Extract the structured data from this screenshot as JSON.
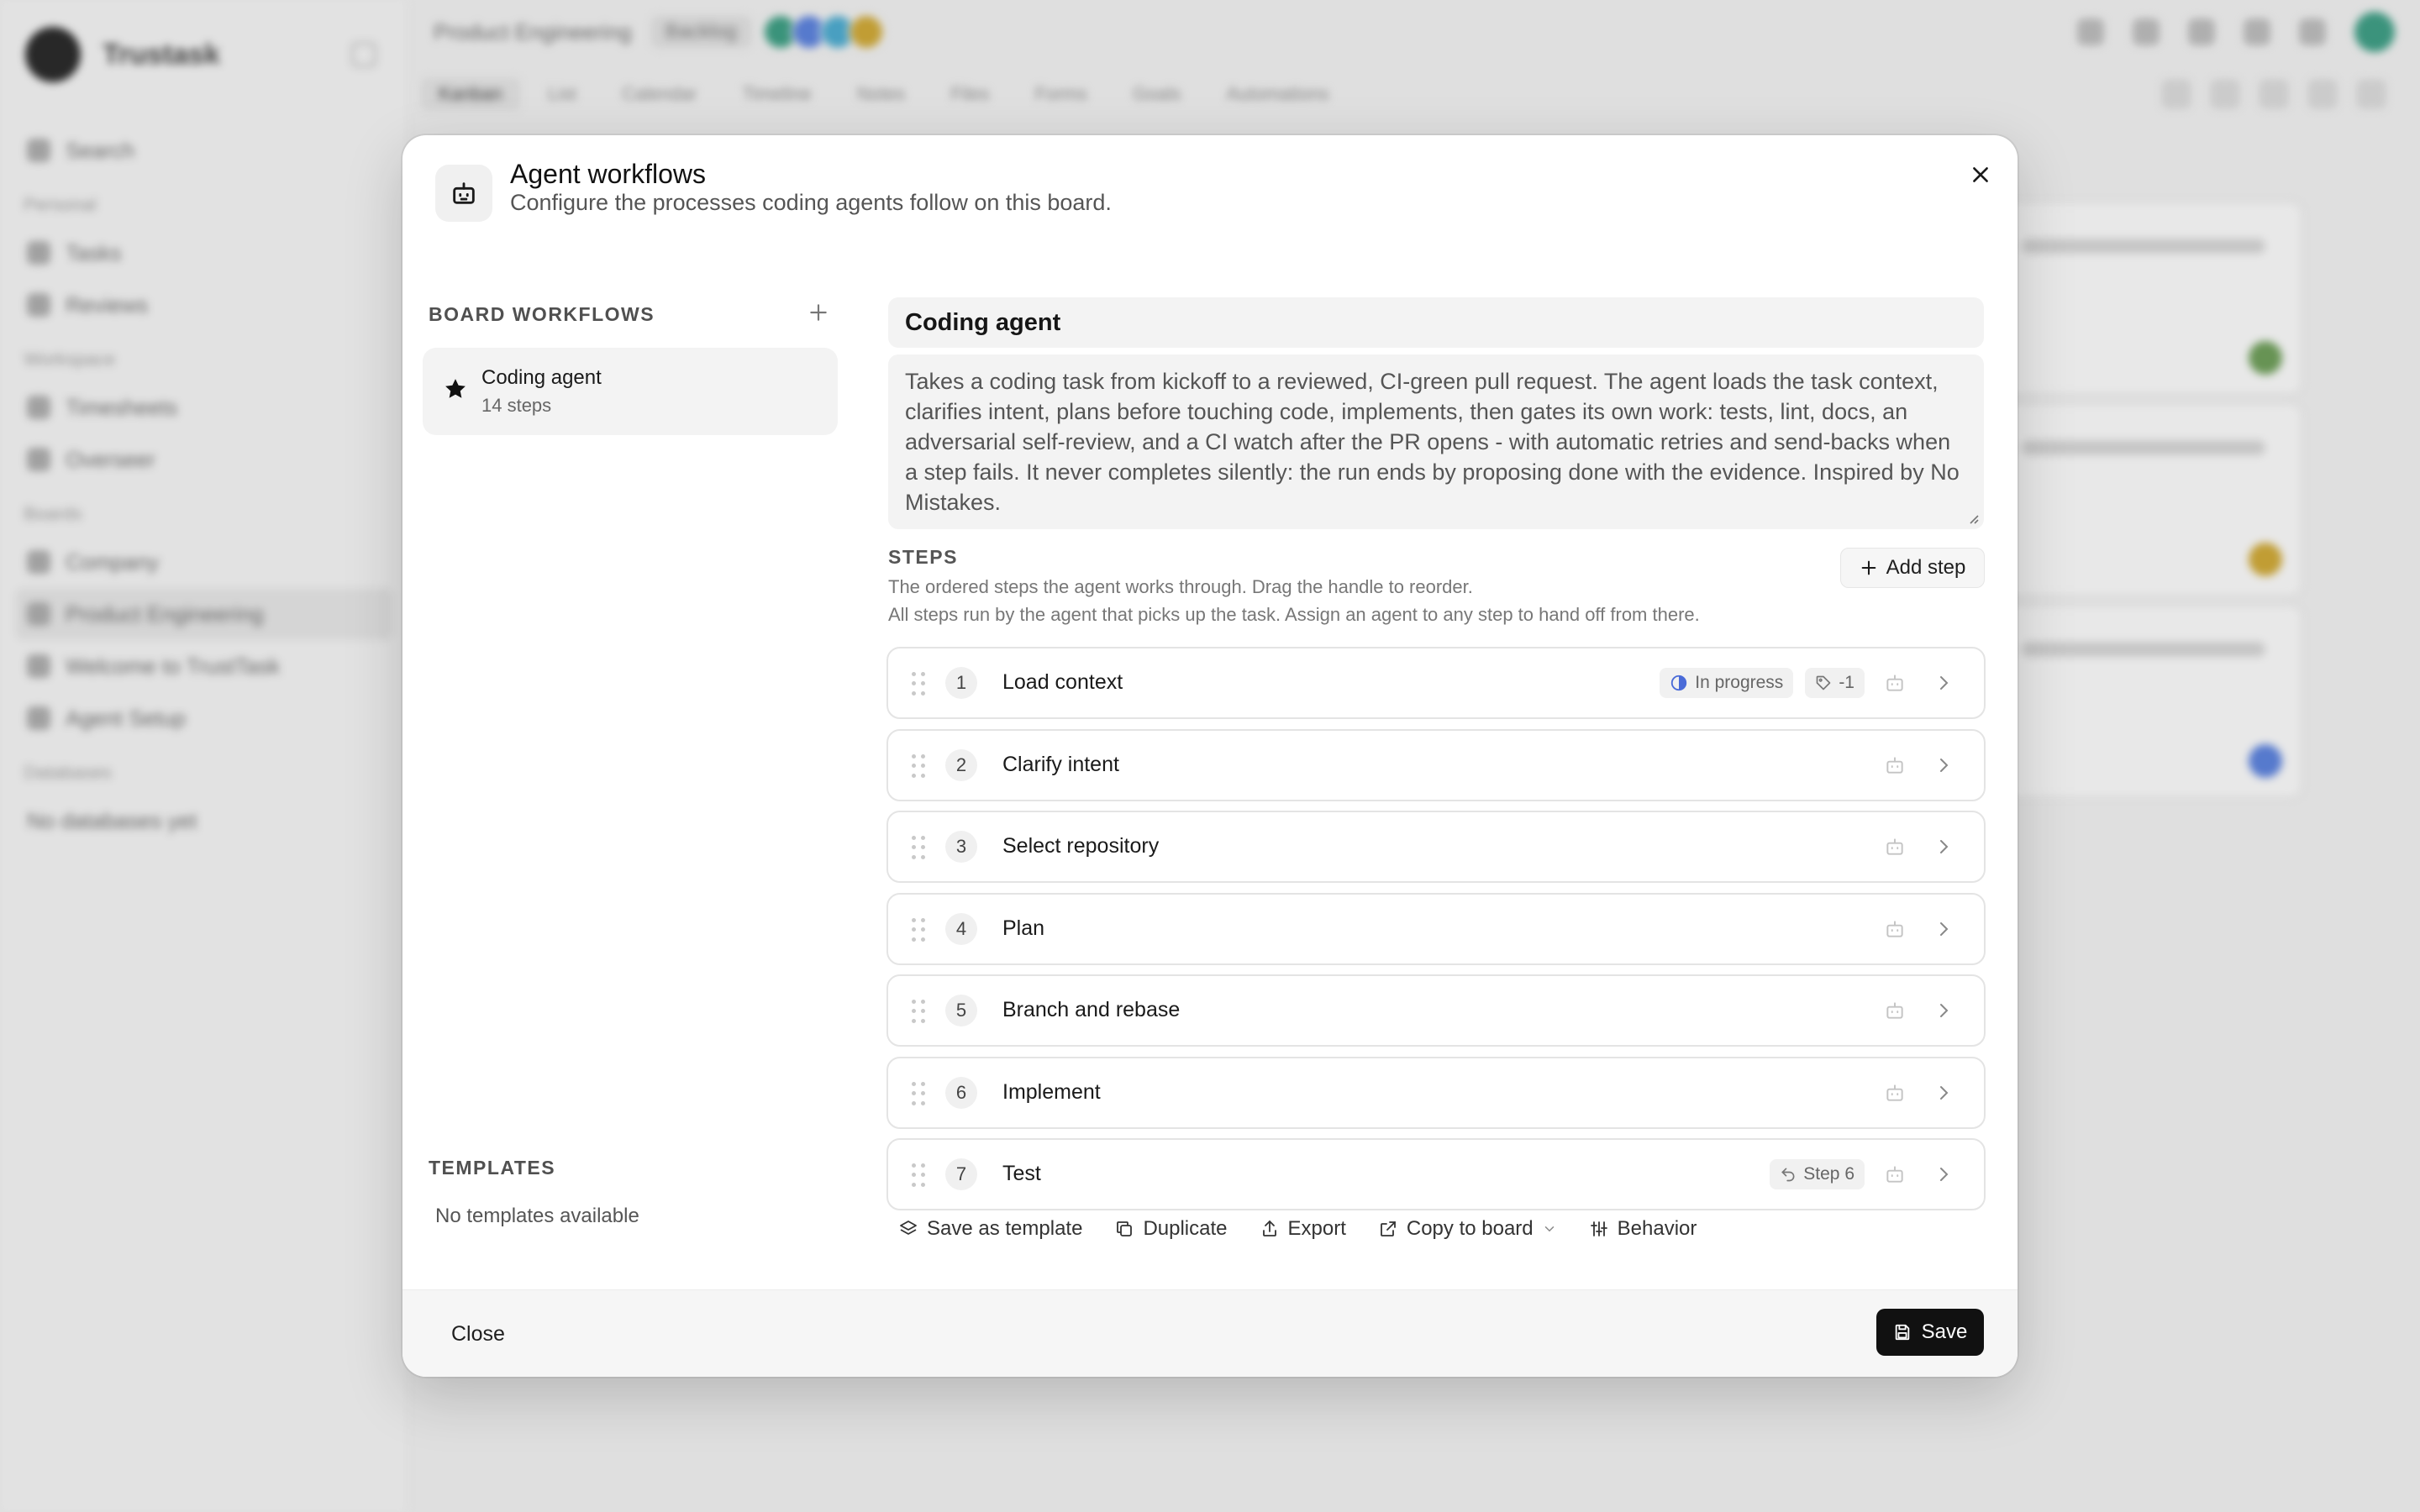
{
  "background": {
    "brand": "Trustask",
    "sidebar": {
      "items": [
        "Search",
        "Personal",
        "Tasks",
        "Reviews",
        "Workspace",
        "Timesheets",
        "Overseer",
        "Boards",
        "Company",
        "Product Engineering",
        "Welcome to TrustTask",
        "Agent Setup",
        "Databases",
        "No databases yet"
      ],
      "active": "Product Engineering"
    },
    "topbar": {
      "crumb": "Product Engineering",
      "pill": "Backlog"
    },
    "views": [
      "Kanban",
      "List",
      "Calendar",
      "Timeline",
      "Notes",
      "Files",
      "Forms",
      "Goals",
      "Automations"
    ]
  },
  "modal": {
    "title": "Agent workflows",
    "subtitle": "Configure the processes coding agents follow on this board.",
    "close_icon": "close-icon",
    "board_workflows_title": "BOARD WORKFLOWS",
    "workflows": [
      {
        "name": "Coding agent",
        "meta": "14 steps"
      }
    ],
    "templates_title": "TEMPLATES",
    "templates_empty": "No templates available",
    "editor": {
      "name": "Coding agent",
      "description": "Takes a coding task from kickoff to a reviewed, CI-green pull request. The agent loads the task context, clarifies intent, plans before touching code, implements, then gates its own work: tests, lint, docs, an adversarial self-review, and a CI watch after the PR opens - with automatic retries and send-backs when a step fails. It never completes silently: the run ends by proposing done with the evidence. Inspired by No Mistakes.",
      "steps_title": "STEPS",
      "steps_help_1": "The ordered steps the agent works through. Drag the handle to reorder.",
      "steps_help_2": "All steps run by the agent that picks up the task. Assign an agent to any step to hand off from there.",
      "add_step": "Add step",
      "steps": [
        {
          "num": "1",
          "name": "Load context",
          "status": "In progress",
          "tag": "-1",
          "back": ""
        },
        {
          "num": "2",
          "name": "Clarify intent",
          "status": "",
          "tag": "",
          "back": ""
        },
        {
          "num": "3",
          "name": "Select repository",
          "status": "",
          "tag": "",
          "back": ""
        },
        {
          "num": "4",
          "name": "Plan",
          "status": "",
          "tag": "",
          "back": ""
        },
        {
          "num": "5",
          "name": "Branch and rebase",
          "status": "",
          "tag": "",
          "back": ""
        },
        {
          "num": "6",
          "name": "Implement",
          "status": "",
          "tag": "",
          "back": ""
        },
        {
          "num": "7",
          "name": "Test",
          "status": "",
          "tag": "",
          "back": "Step 6"
        }
      ],
      "actions": {
        "save_template": "Save as template",
        "duplicate": "Duplicate",
        "export": "Export",
        "copy_to_board": "Copy to board",
        "behavior": "Behavior"
      }
    },
    "footer": {
      "close": "Close",
      "save": "Save"
    }
  }
}
